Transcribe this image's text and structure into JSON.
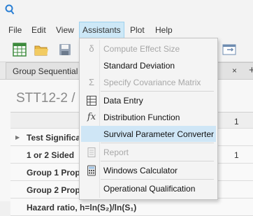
{
  "menubar": {
    "items": [
      {
        "label": "File"
      },
      {
        "label": "Edit"
      },
      {
        "label": "View"
      },
      {
        "label": "Assistants",
        "active": true
      },
      {
        "label": "Plot"
      },
      {
        "label": "Help"
      }
    ]
  },
  "tabs": {
    "active_label": "Group Sequential",
    "close_glyph": "×",
    "add_glyph": "+"
  },
  "document": {
    "title": "STT12-2 / G",
    "rows": [
      {
        "label": "",
        "value": "1"
      },
      {
        "label": "Test Significa",
        "value": ""
      },
      {
        "label": "1 or 2 Sided",
        "value": "1"
      },
      {
        "label": "Group 1 Prop",
        "value": ""
      },
      {
        "label": "Group 2 Prop",
        "value": ""
      },
      {
        "label": "Hazard ratio, h=ln(S₂)/ln(S₁)",
        "value": ""
      }
    ]
  },
  "assistants_menu": {
    "items": [
      {
        "label": "Compute Effect Size",
        "icon": "delta-icon",
        "enabled": false
      },
      {
        "label": "Standard Deviation",
        "icon": "",
        "enabled": true
      },
      {
        "label": "Specify Covariance Matrix",
        "icon": "sigma-icon",
        "enabled": false
      },
      {
        "label": "Data Entry",
        "icon": "data-entry-icon",
        "enabled": true
      },
      {
        "label": "Distribution Function",
        "icon": "fx-icon",
        "enabled": true
      },
      {
        "label": "Survival Parameter Converter",
        "icon": "",
        "enabled": true,
        "highlighted": true
      },
      {
        "label": "Report",
        "icon": "report-icon",
        "enabled": false
      },
      {
        "label": "Windows Calculator",
        "icon": "calculator-icon",
        "enabled": true
      },
      {
        "label": "Operational Qualification",
        "icon": "",
        "enabled": true
      }
    ]
  },
  "colors": {
    "menu_highlight": "#cfe6f6",
    "accent": "#2a7fd4"
  }
}
